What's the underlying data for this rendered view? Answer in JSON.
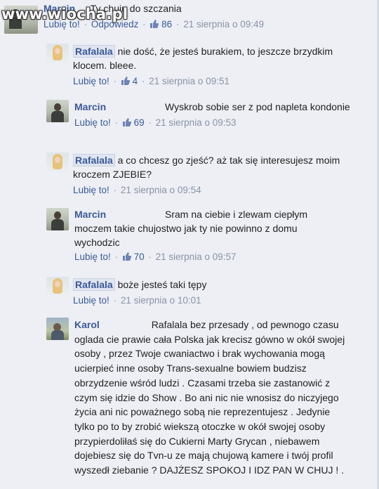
{
  "watermark": "www.wiocha.pl",
  "comments": [
    {
      "author": "Marcin",
      "text": "Ty chuju do szczania",
      "like_label": "Lubię to!",
      "reply_label": "Odpowiedz",
      "likes": "86",
      "time": "21 sierpnia o 09:49"
    },
    {
      "author": "Rafalala",
      "text": "nie dość, że jesteś burakiem, to jeszcze brzydkim klocem. bleee.",
      "like_label": "Lubię to!",
      "likes": "4",
      "time": "21 sierpnia o 09:51"
    },
    {
      "author": "Marcin",
      "text": "Wyskrob sobie ser z pod napleta kondonie",
      "like_label": "Lubię to!",
      "likes": "69",
      "time": "21 sierpnia o 09:53"
    },
    {
      "author": "Rafalala",
      "text": "a co chcesz go zjeść? aż tak się interesujesz moim kroczem ZJEBIE?",
      "like_label": "Lubię to!",
      "time": "21 sierpnia o 09:54"
    },
    {
      "author": "Marcin",
      "text": "Sram na ciebie i zlewam ciepłym moczem takie chujostwo jak ty nie powinno z domu wychodzic",
      "like_label": "Lubię to!",
      "likes": "70",
      "time": "21 sierpnia o 09:57"
    },
    {
      "author": "Rafalala",
      "text": "boże jesteś taki tępy",
      "like_label": "Lubię to!",
      "time": "21 sierpnia o 10:01"
    },
    {
      "author": "Karol",
      "text": "Rafalala bez przesady , od pewnogo czasu oglada cie prawie cała Polska jak krecisz gówno w okół swojej osoby , przez Twoje cwaniactwo i brak wychowania mogą ucierpieć inne osoby Trans-sexualne bowiem budzisz obrzydzenie wśród ludzi . Czasami trzeba sie zastanowić z czym się idzie do Show . Bo ani nic nie wnosisz do niczyjego życia ani nic poważnego sobą nie reprezentujesz . Jedynie tylko po to by zrobić wiekszą otoczke w okół swojej osoby przypierdoliłaś się do Cukierni Marty Grycan , niebawem dojebiesz się do Tvn-u ze mają chujową kamere i twój profil wyszedł ziebanie ? DAJŻESZ SPOKOJ I IDZ PAN W CHUJ ! ."
    }
  ]
}
